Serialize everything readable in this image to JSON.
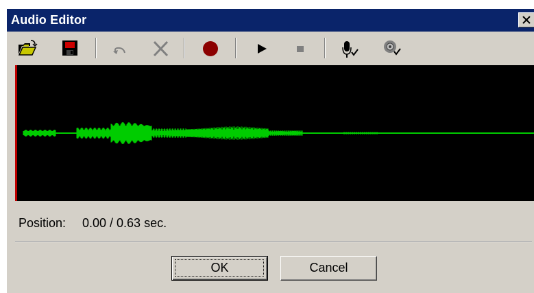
{
  "window": {
    "title": "Audio Editor"
  },
  "toolbar": {
    "buttons": [
      {
        "icon": "open-folder-icon",
        "enabled": true
      },
      {
        "icon": "save-disk-icon",
        "enabled": true
      },
      {
        "icon": "undo-icon",
        "enabled": false
      },
      {
        "icon": "delete-icon",
        "enabled": false
      },
      {
        "icon": "record-icon",
        "enabled": true
      },
      {
        "icon": "play-icon",
        "enabled": true
      },
      {
        "icon": "stop-icon",
        "enabled": false
      },
      {
        "icon": "microphone-check-icon",
        "enabled": true
      },
      {
        "icon": "volume-check-icon",
        "enabled": true
      }
    ]
  },
  "waveform": {
    "background": "#000000",
    "wave_color": "#00cc00",
    "marker_color": "#c00000"
  },
  "status": {
    "position_label": "Position:",
    "position_value": "0.00 / 0.63 sec."
  },
  "buttons": {
    "ok_label": "OK",
    "cancel_label": "Cancel"
  },
  "colors": {
    "title_bar": "#0a246a",
    "face": "#d4d0c8"
  }
}
